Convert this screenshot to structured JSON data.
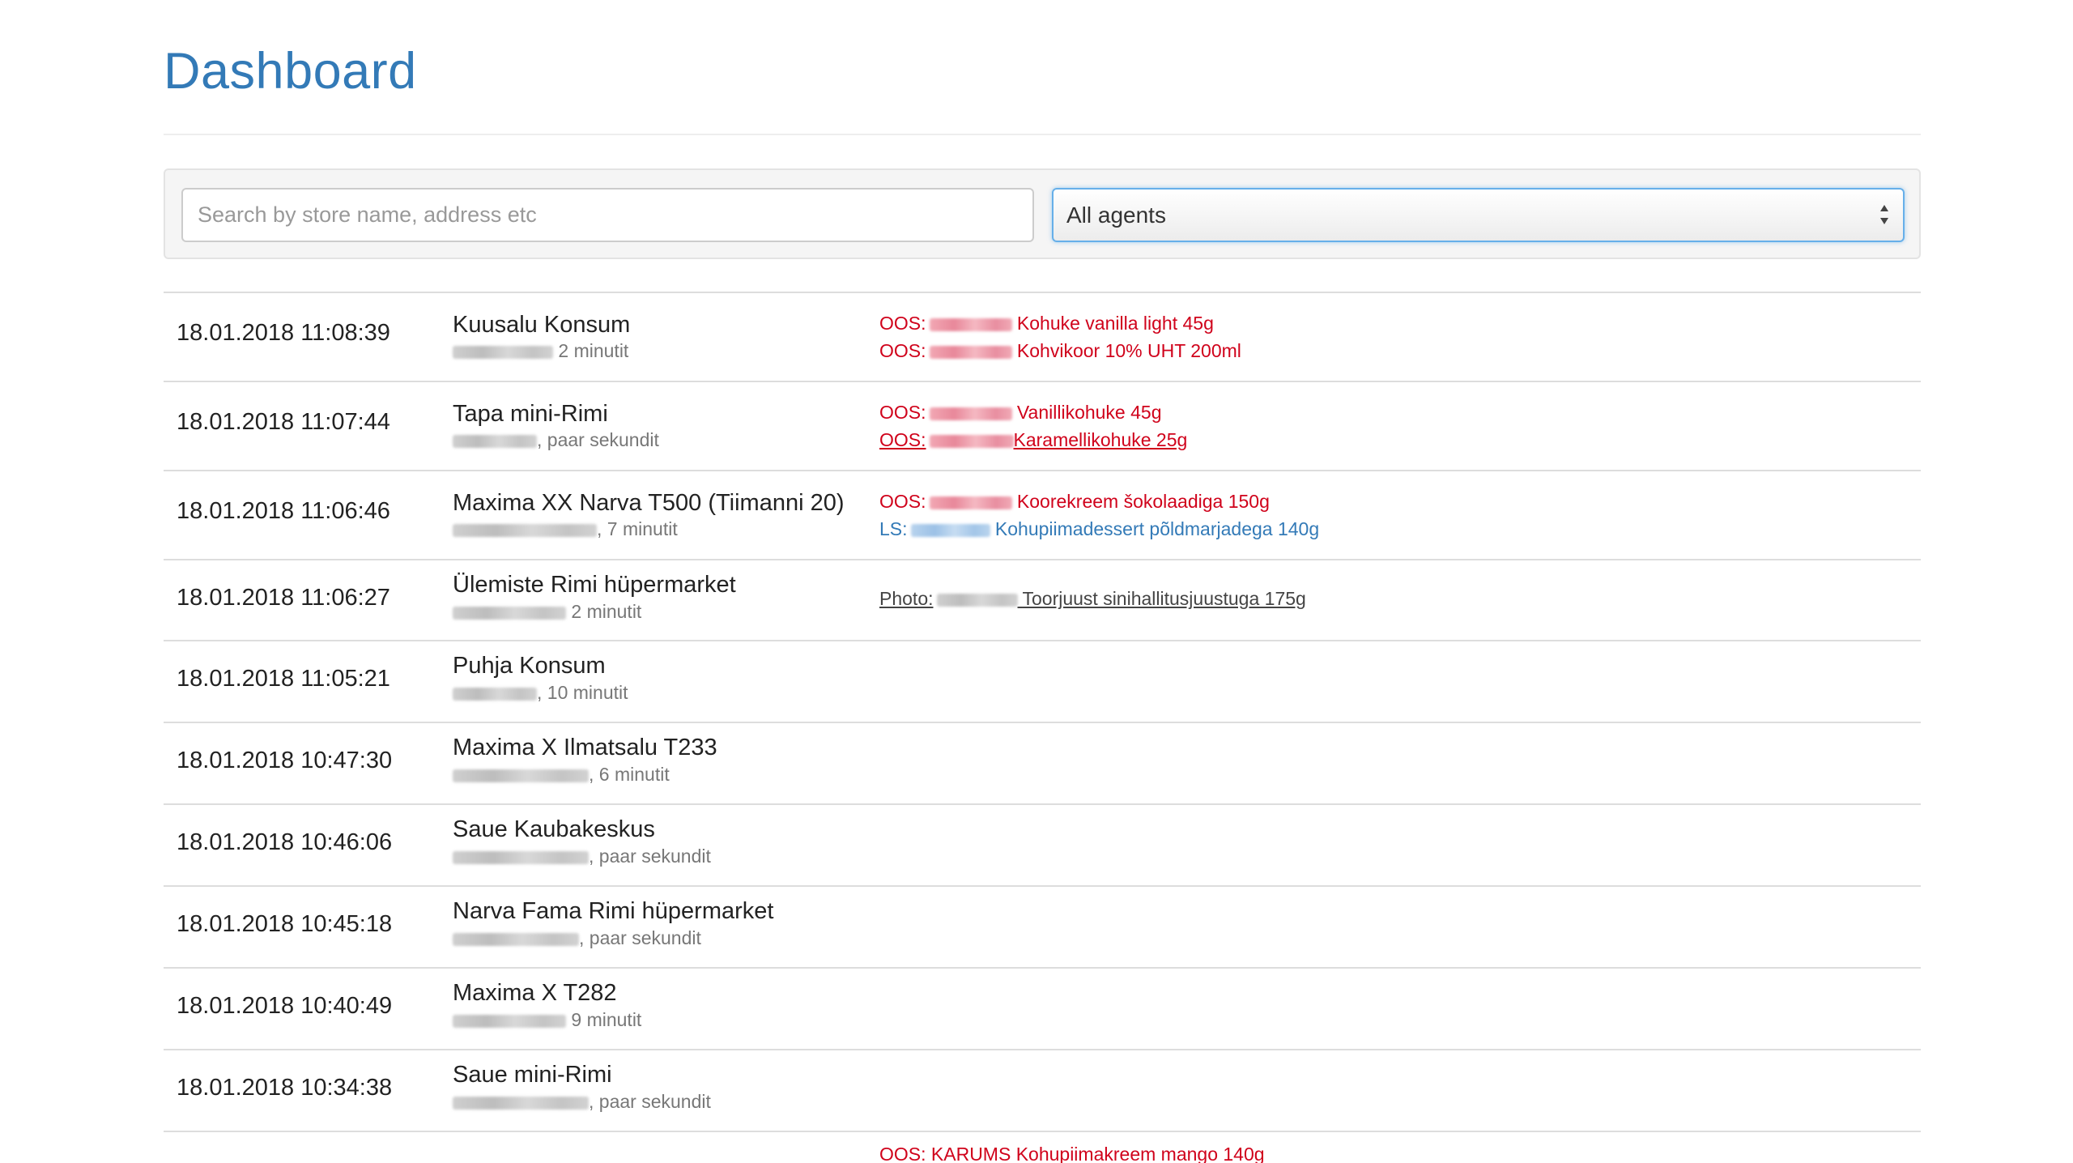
{
  "page": {
    "title": "Dashboard"
  },
  "filters": {
    "search_placeholder": "Search by store name, address etc",
    "agent_select": "All agents"
  },
  "colors": {
    "accent": "#337ab7",
    "oos": "#d0021b",
    "ls": "#337ab7"
  },
  "visits": [
    {
      "time": "18.01.2018 11:08:39",
      "store": "Kuusalu Konsum",
      "duration": "2 minutit",
      "notes": [
        {
          "kind": "oos",
          "prefix": "OOS:",
          "product": "Kohuke vanilla light 45g"
        },
        {
          "kind": "oos",
          "prefix": "OOS:",
          "product": "Kohvikoor 10% UHT 200ml"
        }
      ]
    },
    {
      "time": "18.01.2018 11:07:44",
      "store": "Tapa mini-Rimi",
      "duration": ", paar sekundit",
      "notes": [
        {
          "kind": "oos",
          "prefix": "OOS:",
          "product": "Vanillikohuke 45g"
        },
        {
          "kind": "oos",
          "prefix": "OOS:",
          "product": "Karamellikohuke 25g"
        }
      ]
    },
    {
      "time": "18.01.2018 11:06:46",
      "store": "Maxima XX Narva T500 (Tiimanni 20)",
      "duration": ", 7 minutit",
      "notes": [
        {
          "kind": "oos",
          "prefix": "OOS:",
          "product": "Koorekreem šokolaadiga 150g"
        },
        {
          "kind": "ls",
          "prefix": "LS:",
          "product": "Kohupiimadessert põldmarjadega 140g"
        }
      ]
    },
    {
      "time": "18.01.2018 11:06:27",
      "store": "Ülemiste Rimi hüpermarket",
      "duration": "2 minutit",
      "notes": [
        {
          "kind": "photo",
          "prefix": "Photo:",
          "product": "Toorjuust sinihallitusjuustuga 175g"
        }
      ]
    },
    {
      "time": "18.01.2018 11:05:21",
      "store": "Puhja Konsum",
      "duration": ", 10 minutit",
      "notes": []
    },
    {
      "time": "18.01.2018 10:47:30",
      "store": "Maxima X Ilmatsalu T233",
      "duration": ", 6 minutit",
      "notes": []
    },
    {
      "time": "18.01.2018 10:46:06",
      "store": "Saue Kaubakeskus",
      "duration": ", paar sekundit",
      "notes": []
    },
    {
      "time": "18.01.2018 10:45:18",
      "store": "Narva Fama Rimi hüpermarket",
      "duration": ", paar sekundit",
      "notes": []
    },
    {
      "time": "18.01.2018 10:40:49",
      "store": "Maxima X T282",
      "duration": "9 minutit",
      "notes": []
    },
    {
      "time": "18.01.2018 10:34:38",
      "store": "Saue mini-Rimi",
      "duration": ", paar sekundit",
      "notes": []
    }
  ],
  "next_row_partial": "OOS: KARUMS Kohupiimakreem mango 140g"
}
